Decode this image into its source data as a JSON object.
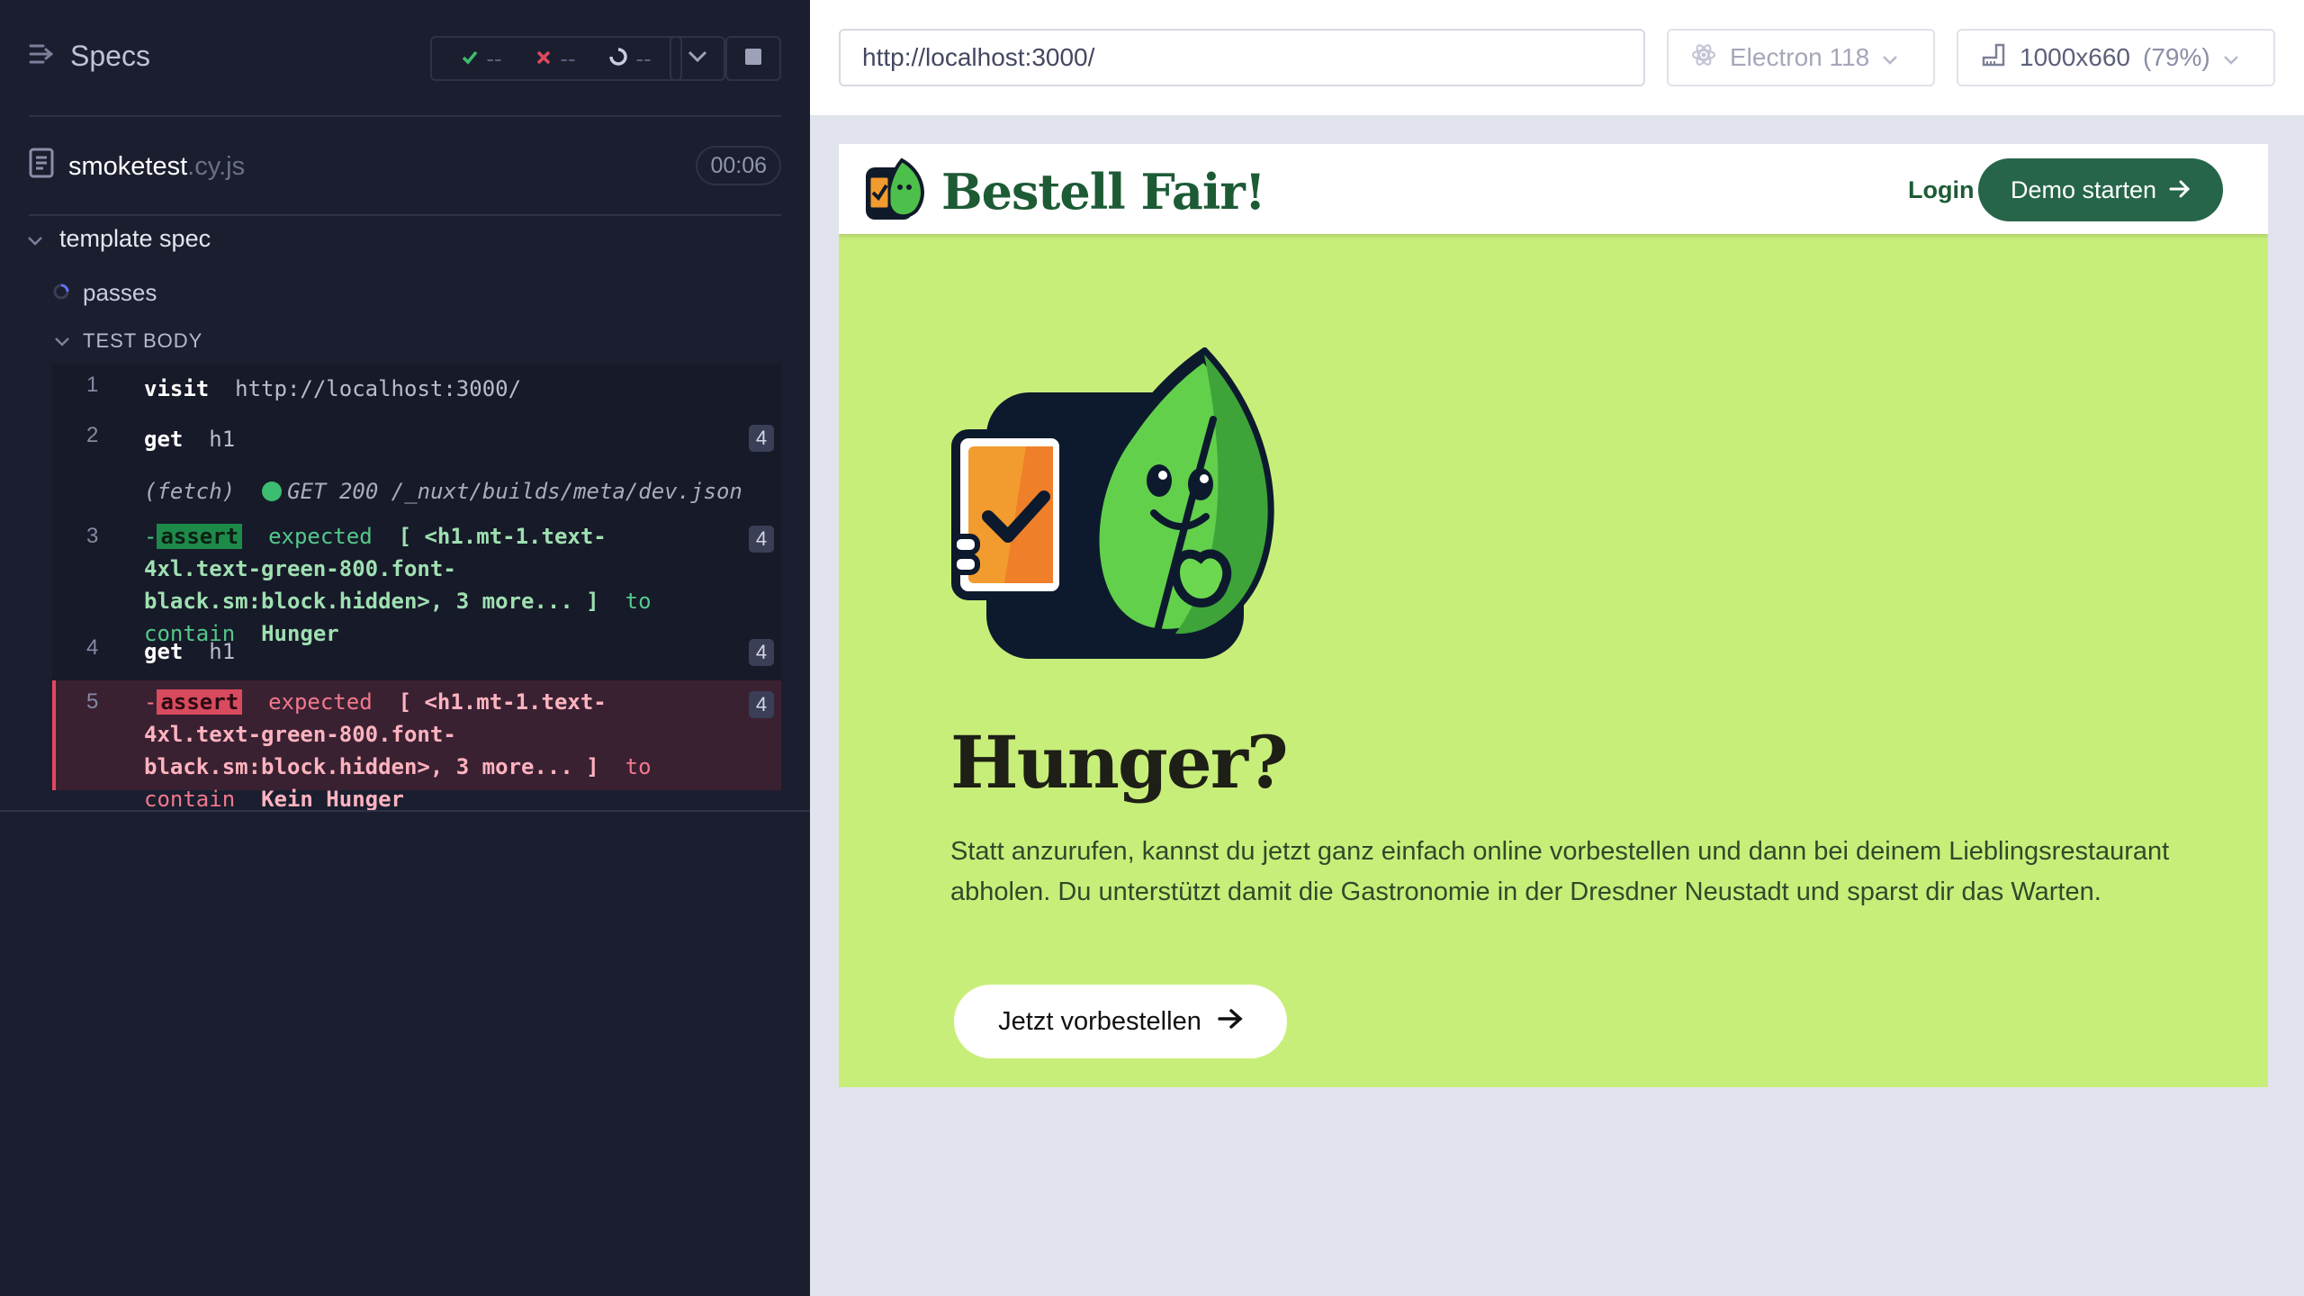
{
  "runner": {
    "specs_label": "Specs",
    "stats": {
      "passed": "--",
      "failed": "--",
      "pending": "--"
    },
    "spec_file": {
      "name": "smoketest",
      "ext": ".cy.js",
      "duration": "00:06"
    },
    "suite_title": "template spec",
    "test_title": "passes",
    "test_body_label": "TEST BODY",
    "commands": [
      {
        "num": "1",
        "name": "visit",
        "arg": "http://localhost:3000/"
      },
      {
        "num": "2",
        "name": "get",
        "arg": "h1",
        "badge": "4"
      },
      {
        "fetch_label": "(fetch)",
        "fetch_text": "GET 200 /_nuxt/builds/meta/dev.json"
      },
      {
        "num": "3",
        "dash": "-",
        "chip": "assert",
        "pre": "expected",
        "subject": "[ <h1.mt-1.text-4xl.text-green-800.font-black.sm:block.hidden>, 3 more... ]",
        "kw": "to contain",
        "value": "Hunger",
        "badge": "4"
      },
      {
        "num": "4",
        "name": "get",
        "arg": "h1",
        "badge": "4"
      },
      {
        "num": "5",
        "dash": "-",
        "chip": "assert",
        "pre": "expected",
        "subject": "[ <h1.mt-1.text-4xl.text-green-800.font-black.sm:block.hidden>, 3 more... ]",
        "kw": "to contain",
        "value": "Kein Hunger",
        "badge": "4"
      }
    ]
  },
  "browser": {
    "url": "http://localhost:3000/",
    "browser_name": "Electron 118",
    "viewport": "1000x660",
    "zoom": "(79%)"
  },
  "app": {
    "brand": "Bestell Fair!",
    "login": "Login",
    "demo_button": "Demo starten",
    "hero_title": "Hunger?",
    "hero_text": "Statt anzurufen, kannst du jetzt ganz einfach online vorbestellen und dann bei deinem Lieblingsrestaurant abholen. Du unterstützt damit die Gastronomie in der Dresdner Neustadt und sparst dir das Warten.",
    "cta": "Jetzt vorbestellen"
  },
  "colors": {
    "runner_bg": "#1b1e2e",
    "pass": "#1e8a4a",
    "fail": "#d84a5e",
    "hero_bg": "#c8ee7a",
    "brand_green": "#1d5b35",
    "button_green": "#266549"
  }
}
